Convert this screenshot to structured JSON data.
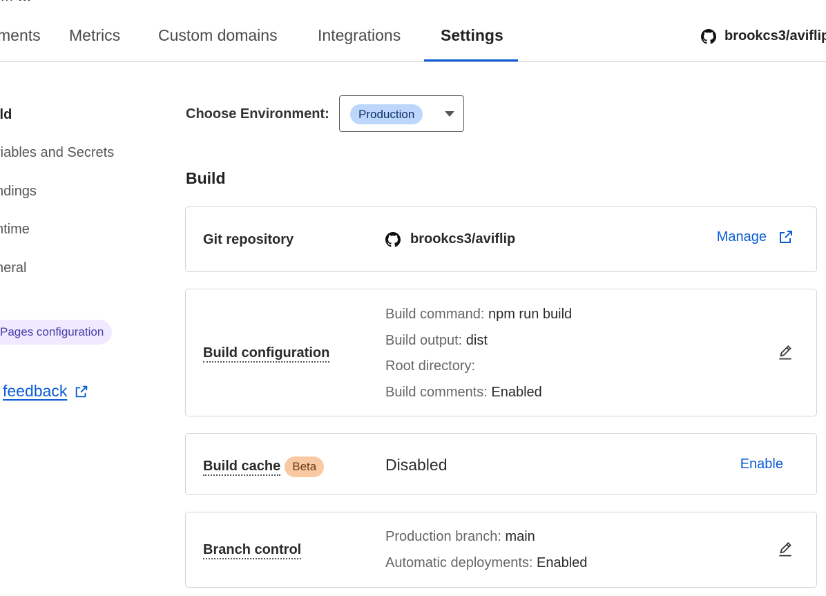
{
  "header": {
    "project_prefix": "…",
    "project_name": "…"
  },
  "tabs": [
    {
      "label": "ments"
    },
    {
      "label": "Metrics"
    },
    {
      "label": "Custom domains"
    },
    {
      "label": "Integrations"
    },
    {
      "label": "Settings"
    }
  ],
  "repo_top": {
    "name": "brookcs3/aviflip"
  },
  "sidebar": {
    "items": [
      {
        "label": "ild"
      },
      {
        "label": "riables and Secrets"
      },
      {
        "label": "ndings"
      },
      {
        "label": "ntime"
      },
      {
        "label": "neral"
      }
    ],
    "pill_label": "Pages configuration",
    "feedback_label": "feedback"
  },
  "environment": {
    "label": "Choose Environment:",
    "selected": "Production"
  },
  "section": {
    "title": "Build"
  },
  "git_card": {
    "title": "Git repository",
    "repo": "brookcs3/aviflip",
    "manage_label": "Manage"
  },
  "build_config": {
    "title": "Build configuration",
    "rows": [
      {
        "key": "Build command:",
        "value": "npm run build"
      },
      {
        "key": "Build output:",
        "value": "dist"
      },
      {
        "key": "Root directory:",
        "value": ""
      },
      {
        "key": "Build comments:",
        "value": "Enabled"
      }
    ]
  },
  "build_cache": {
    "title": "Build cache",
    "badge": "Beta",
    "status": "Disabled",
    "action": "Enable"
  },
  "branch_control": {
    "title": "Branch control",
    "rows": [
      {
        "key": "Production branch:",
        "value": "main"
      },
      {
        "key": "Automatic deployments:",
        "value": "Enabled"
      }
    ]
  },
  "colors": {
    "accent": "#0b5bd7",
    "env_badge": "#bcd7fb",
    "beta_badge": "#f8c9a3",
    "pill": "#efeaff"
  },
  "icons": {
    "github": "github-icon",
    "external": "external-link-icon",
    "edit": "pencil-icon",
    "dropdown": "caret-down-icon"
  }
}
